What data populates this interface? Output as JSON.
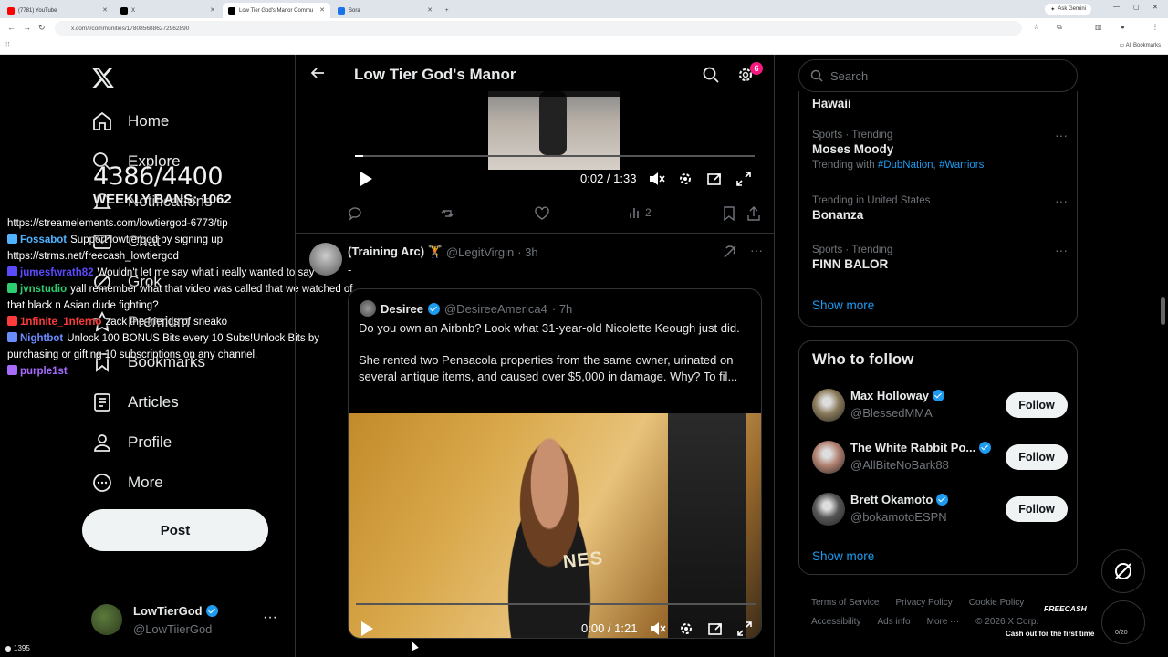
{
  "browser": {
    "tabs": [
      {
        "label": "(7781) YouTube",
        "color": "#ff0000"
      },
      {
        "label": "X",
        "color": "#000000"
      },
      {
        "label": "Low Tier God's Manor Commu",
        "color": "#000000"
      },
      {
        "label": "Sora",
        "color": "#1a73e8"
      }
    ],
    "ask_gemini": "Ask Gemini",
    "url": "x.com/i/communities/1780856886272962890",
    "all_bookmarks": "All Bookmarks"
  },
  "nav": {
    "items": [
      {
        "label": "Home",
        "icon": "home-icon"
      },
      {
        "label": "Explore",
        "icon": "search-icon"
      },
      {
        "label": "Notifications",
        "icon": "bell-icon"
      },
      {
        "label": "Chat",
        "icon": "mail-icon"
      },
      {
        "label": "Grok",
        "icon": "grok-icon"
      },
      {
        "label": "Premium",
        "icon": "premium-icon"
      },
      {
        "label": "Bookmarks",
        "icon": "bookmark-icon"
      },
      {
        "label": "Articles",
        "icon": "articles-icon"
      },
      {
        "label": "Profile",
        "icon": "profile-icon"
      },
      {
        "label": "More",
        "icon": "more-circle-icon"
      }
    ],
    "post_label": "Post",
    "account": {
      "name": "LowTierGod",
      "handle": "@LowTiierGod"
    }
  },
  "overlay": {
    "count": "4386/4400",
    "weekly": "WEEKLY BANS: 1062",
    "chat": [
      {
        "user": "",
        "user_color": "#ffffff",
        "text": "https://streamelements.com/lowtiergod-6773/tip"
      },
      {
        "user": "Fossabot",
        "user_color": "#4fb3ff",
        "text": "Support lowtiergod by signing up https://strms.net/freecash_lowtiergod"
      },
      {
        "user": "jumesfwrath82",
        "user_color": "#5b4bff",
        "text": "Wouldn't let me say what i really wanted to say"
      },
      {
        "user": "jvnstudio",
        "user_color": "#2ecc71",
        "text": "yall remember what that video was called that we watched of that black n Asian dude fighting?"
      },
      {
        "user": "1nfinite_1nferno",
        "user_color": "#ff3b3b",
        "text": "zack the friends of sneako"
      },
      {
        "user": "Nightbot",
        "user_color": "#6a8cff",
        "text": "Unlock 100 BONUS Bits every 10 Subs!Unlock Bits by purchasing or gifting 10 subscriptions on any channel."
      },
      {
        "user": "purple1st",
        "user_color": "#a86bff",
        "text": ""
      }
    ],
    "viewers": "1395"
  },
  "main": {
    "title": "Low Tier God's Manor",
    "notif_count": "6",
    "video1": {
      "time": "0:02 / 1:33",
      "progress": 0.02
    },
    "tweet1_actions": {
      "views": "2"
    },
    "tweet2": {
      "name": "(Training Arc) 🏋",
      "handle": "@LegitVirgin",
      "time": "· 3h",
      "body": "-"
    },
    "quote": {
      "name": "Desiree",
      "handle": "@DesireeAmerica4",
      "time": "· 7h",
      "p1": "Do you own an Airbnb? Look what 31-year-old Nicolette Keough just did.",
      "p2": "She rented two Pensacola properties from the same owner, urinated on several antique items, and caused over $5,000 in damage. Why? To fil...",
      "sign": "NES",
      "video_time": "0:00 / 1:21",
      "progress": 0.0
    }
  },
  "right": {
    "search_placeholder": "Search",
    "trends": [
      {
        "category": "",
        "name": "Hawaii",
        "with": null
      },
      {
        "category": "Sports · Trending",
        "name": "Moses Moody",
        "with": {
          "prefix": "Trending with",
          "tags": [
            "#DubNation",
            "#Warriors"
          ]
        }
      },
      {
        "category": "Trending in United States",
        "name": "Bonanza",
        "with": null
      },
      {
        "category": "Sports · Trending",
        "name": "FINN BALOR",
        "with": null
      }
    ],
    "show_more": "Show more",
    "wtf_title": "Who to follow",
    "follow": [
      {
        "name": "Max Holloway",
        "handle": "@BlessedMMA",
        "color": "#8a7a5a"
      },
      {
        "name": "The White Rabbit Po...",
        "handle": "@AllBiteNoBark88",
        "color": "#b08070"
      },
      {
        "name": "Brett Okamoto",
        "handle": "@bokamotoESPN",
        "color": "#555555"
      }
    ],
    "follow_label": "Follow",
    "show_more2": "Show more",
    "footer": [
      "Terms of Service",
      "Privacy Policy",
      "Cookie Policy",
      "Accessibility",
      "Ads info",
      "More ···",
      "© 2026 X Corp."
    ]
  },
  "freecash": {
    "logo": "FREECASH",
    "tagline": "Cash out for the first time",
    "counter": "0/20"
  }
}
